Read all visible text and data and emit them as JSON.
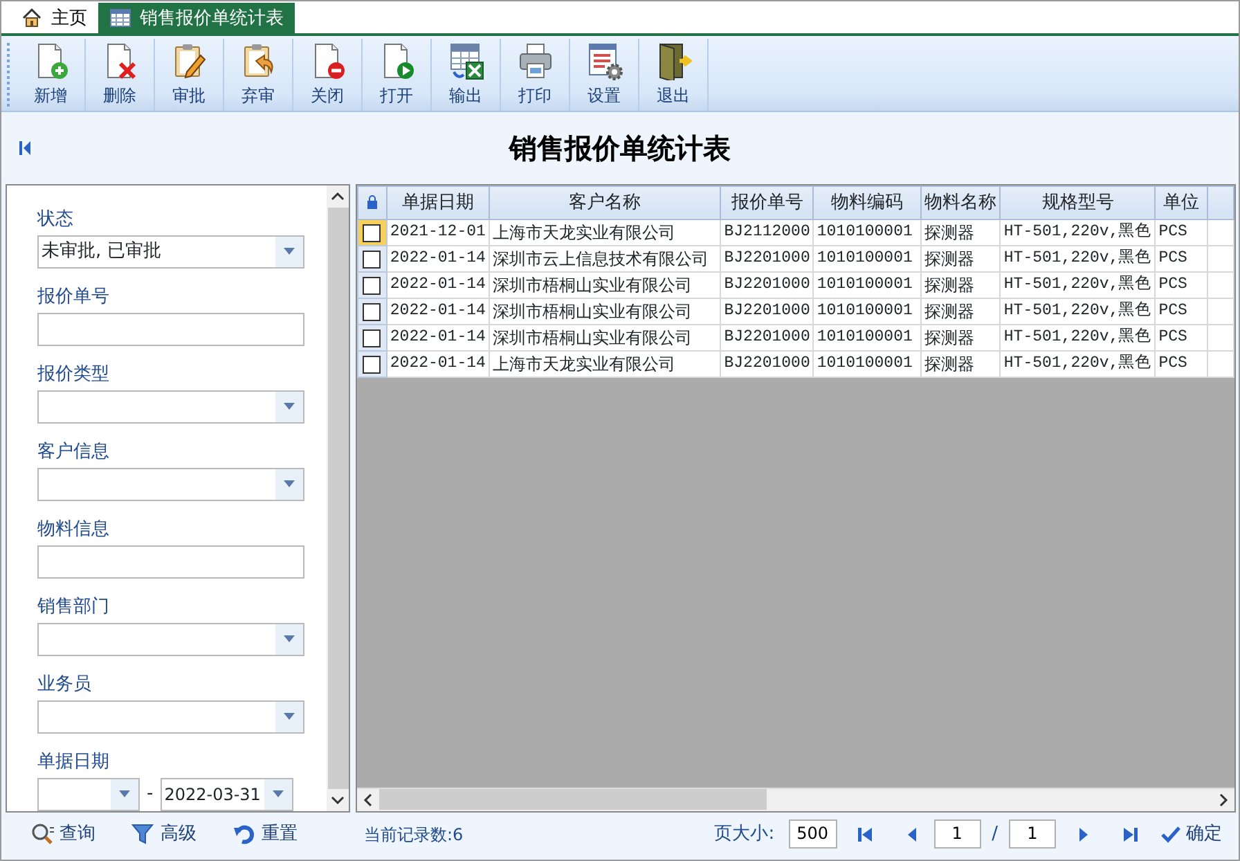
{
  "tabs": [
    {
      "label": "主页",
      "kind": "home",
      "selected": false
    },
    {
      "label": "销售报价单统计表",
      "kind": "table",
      "selected": true
    }
  ],
  "toolbar": [
    {
      "label": "新增",
      "kind": "new"
    },
    {
      "label": "删除",
      "kind": "delete"
    },
    {
      "label": "审批",
      "kind": "approve"
    },
    {
      "label": "弃审",
      "kind": "unapprove"
    },
    {
      "label": "关闭",
      "kind": "close"
    },
    {
      "label": "打开",
      "kind": "open"
    },
    {
      "label": "输出",
      "kind": "export"
    },
    {
      "label": "打印",
      "kind": "print"
    },
    {
      "label": "设置",
      "kind": "settings"
    },
    {
      "label": "退出",
      "kind": "exit"
    }
  ],
  "title": "销售报价单统计表",
  "filters": [
    {
      "label": "状态",
      "kind": "select",
      "value": "未审批, 已审批"
    },
    {
      "label": "报价单号",
      "kind": "text"
    },
    {
      "label": "报价类型",
      "kind": "select"
    },
    {
      "label": "客户信息",
      "kind": "select"
    },
    {
      "label": "物料信息",
      "kind": "text"
    },
    {
      "label": "销售部门",
      "kind": "select"
    },
    {
      "label": "业务员",
      "kind": "select"
    },
    {
      "label": "单据日期",
      "kind": "daterange",
      "separator": "-",
      "to": "2022-03-31"
    }
  ],
  "filter_actions": [
    {
      "label": "查询",
      "kind": "search"
    },
    {
      "label": "高级",
      "kind": "filter"
    },
    {
      "label": "重置",
      "kind": "undo"
    }
  ],
  "table": {
    "columns": [
      "单据日期",
      "客户名称",
      "报价单号",
      "物料编码",
      "物料名称",
      "规格型号",
      "单位"
    ],
    "rows": [
      {
        "checked": false,
        "focused": true,
        "cells": [
          "2021-12-01",
          "上海市天龙实业有限公司",
          "BJ2112000",
          "1010100001",
          "探测器",
          "HT-501,220v,黑色",
          "PCS"
        ]
      },
      {
        "checked": false,
        "focused": false,
        "cells": [
          "2022-01-14",
          "深圳市云上信息技术有限公司",
          "BJ2201000",
          "1010100001",
          "探测器",
          "HT-501,220v,黑色",
          "PCS"
        ]
      },
      {
        "checked": false,
        "focused": false,
        "cells": [
          "2022-01-14",
          "深圳市梧桐山实业有限公司",
          "BJ2201000",
          "1010100001",
          "探测器",
          "HT-501,220v,黑色",
          "PCS"
        ]
      },
      {
        "checked": false,
        "focused": false,
        "cells": [
          "2022-01-14",
          "深圳市梧桐山实业有限公司",
          "BJ2201000",
          "1010100001",
          "探测器",
          "HT-501,220v,黑色",
          "PCS"
        ]
      },
      {
        "checked": false,
        "focused": false,
        "cells": [
          "2022-01-14",
          "深圳市梧桐山实业有限公司",
          "BJ2201000",
          "1010100001",
          "探测器",
          "HT-501,220v,黑色",
          "PCS"
        ]
      },
      {
        "checked": false,
        "focused": false,
        "cells": [
          "2022-01-14",
          "上海市天龙实业有限公司",
          "BJ2201000",
          "1010100001",
          "探测器",
          "HT-501,220v,黑色",
          "PCS"
        ]
      }
    ]
  },
  "status": {
    "record_count": "当前记录数:6",
    "page_size_label": "页大小:",
    "page_size": "500",
    "page": "1",
    "separator": "/",
    "total_pages": "1",
    "confirm": "确定"
  }
}
